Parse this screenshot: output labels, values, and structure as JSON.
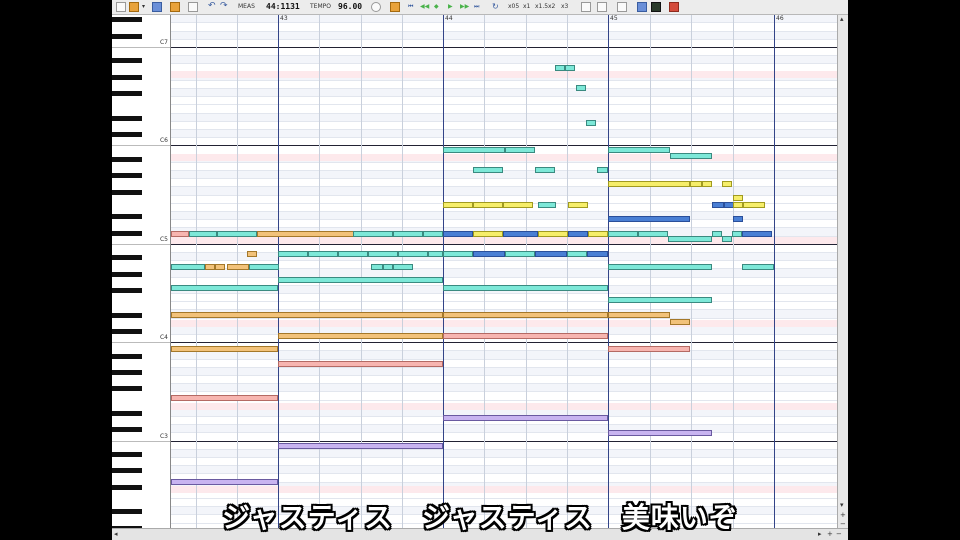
{
  "toolbar": {
    "meas_label": "MEAS",
    "meas_value": "44:1131",
    "tempo_label": "TEMPO",
    "tempo_value": "96.00",
    "zoom_labels": [
      "x05",
      "x1",
      "x1.5",
      "x2",
      "x3"
    ],
    "icons": [
      "new-file-icon",
      "open-folder-icon",
      "dropdown-icon",
      "save-icon",
      "export-icon",
      "document-icon",
      "undo-icon",
      "redo-icon",
      "settings-icon",
      "goto-start-icon",
      "rewind-icon",
      "back-icon",
      "play-icon",
      "forward-icon",
      "goto-end-icon",
      "loop-icon",
      "grid-icon",
      "select-icon",
      "properties-icon",
      "chart-icon",
      "monitor-icon",
      "wrench-icon"
    ]
  },
  "measures": [
    "43",
    "44",
    "45",
    "46"
  ],
  "octaves": [
    "C7",
    "C6",
    "C5",
    "C4",
    "C3",
    "C2"
  ],
  "subtitle": "ジャスティス　ジャスティス　美味いぞ",
  "colors": {
    "cyan": "#7de8d8",
    "yellow": "#f6ee6a",
    "orange": "#f2c27a",
    "pink": "#f7b5b0",
    "blue": "#4a7fd4",
    "purple": "#c8b4f0",
    "highlight_row": "#fde9ec",
    "bar_line": "#334488"
  }
}
